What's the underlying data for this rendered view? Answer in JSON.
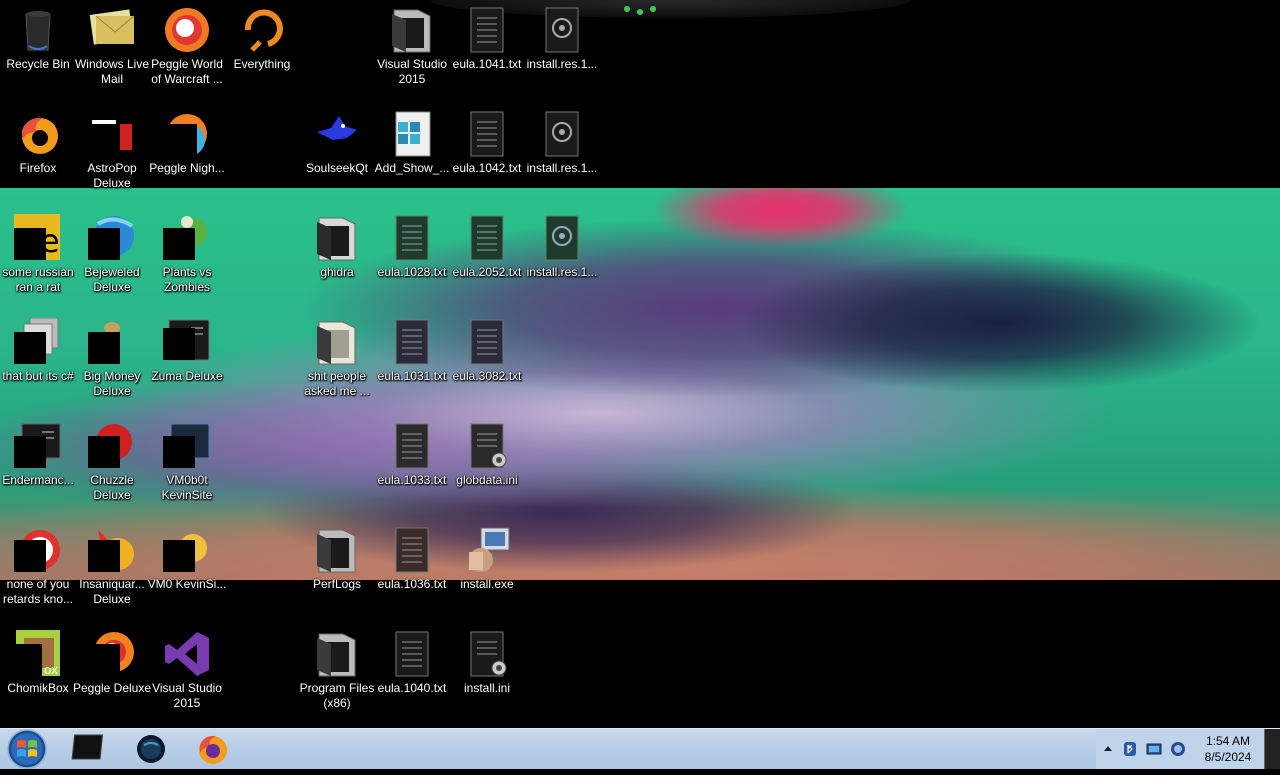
{
  "desktop": {
    "icons": [
      {
        "label": "Recycle Bin",
        "icon": "recycle-bin-icon"
      },
      {
        "label": "Windows Live Mail",
        "icon": "windows-live-mail-icon"
      },
      {
        "label": "Peggle World of Warcraft ...",
        "icon": "peggle-wow-icon"
      },
      {
        "label": "Everything",
        "icon": "everything-search-icon"
      },
      {
        "label": "Visual Studio 2015",
        "icon": "folder-icon"
      },
      {
        "label": "eula.1041.txt",
        "icon": "text-file-icon"
      },
      {
        "label": "install.res.1...",
        "icon": "resource-file-icon"
      },
      {
        "label": "Firefox",
        "icon": "firefox-icon"
      },
      {
        "label": "AstroPop Deluxe",
        "icon": "astropop-icon"
      },
      {
        "label": "Peggle Nigh...",
        "icon": "peggle-nights-icon"
      },
      {
        "label": "SoulseekQt",
        "icon": "soulseek-bird-icon"
      },
      {
        "label": "Add_Show_...",
        "icon": "registry-file-icon"
      },
      {
        "label": "eula.1042.txt",
        "icon": "text-file-icon"
      },
      {
        "label": "install.res.1...",
        "icon": "resource-file-icon"
      },
      {
        "label": "some russian ran a rat",
        "icon": "shortcut-icon"
      },
      {
        "label": "Bejeweled Deluxe",
        "icon": "bejeweled-icon"
      },
      {
        "label": "Plants vs Zombies",
        "icon": "plants-vs-zombies-icon"
      },
      {
        "label": "ghidra",
        "icon": "folder-icon"
      },
      {
        "label": "eula.1028.txt",
        "icon": "text-file-icon"
      },
      {
        "label": "eula.2052.txt",
        "icon": "text-file-icon"
      },
      {
        "label": "install.res.1...",
        "icon": "resource-file-icon"
      },
      {
        "label": "that but its c#",
        "icon": "files-icon"
      },
      {
        "label": "Big Money Deluxe",
        "icon": "big-money-icon"
      },
      {
        "label": "Zuma Deluxe",
        "icon": "zuma-icon"
      },
      {
        "label": "shit people asked me ...",
        "icon": "folder-icon"
      },
      {
        "label": "eula.1031.txt",
        "icon": "text-file-icon"
      },
      {
        "label": "eula.3082.txt",
        "icon": "text-file-icon"
      },
      {
        "label": "Endermanc...",
        "icon": "shortcut-icon"
      },
      {
        "label": "Chuzzle Deluxe",
        "icon": "chuzzle-icon"
      },
      {
        "label": "VM0b0t KevinSite",
        "icon": "shortcut-icon"
      },
      {
        "label": "eula.1033.txt",
        "icon": "text-file-icon"
      },
      {
        "label": "globdata.ini",
        "icon": "settings-file-icon"
      },
      {
        "label": "none of you retards kno...",
        "icon": "shortcut-icon"
      },
      {
        "label": "Insaniquar... Deluxe",
        "icon": "insaniquarium-icon"
      },
      {
        "label": "VM0 KevinSi...",
        "icon": "shortcut-icon"
      },
      {
        "label": "PerfLogs",
        "icon": "folder-icon"
      },
      {
        "label": "eula.1036.txt",
        "icon": "text-file-icon"
      },
      {
        "label": "install.exe",
        "icon": "installer-icon"
      },
      {
        "label": "ChomikBox",
        "icon": "chomikbox-icon"
      },
      {
        "label": "Peggle Deluxe",
        "icon": "peggle-icon"
      },
      {
        "label": "Visual Studio 2015",
        "icon": "visual-studio-icon"
      },
      {
        "label": "Program Files (x86)",
        "icon": "folder-icon"
      },
      {
        "label": "eula.1040.txt",
        "icon": "text-file-icon"
      },
      {
        "label": "install.ini",
        "icon": "settings-file-icon"
      }
    ]
  },
  "taskbar": {
    "start": {
      "icon": "windows-start-orb-icon"
    },
    "pinned": [
      {
        "icon": "terminal-icon"
      },
      {
        "icon": "globe-app-icon"
      },
      {
        "icon": "firefox-icon"
      }
    ],
    "tray": {
      "icons": [
        "show-hidden-icons-arrow-icon",
        "bluetooth-icon",
        "network-icon",
        "volume-icon"
      ],
      "time": "1:54 AM",
      "date": "8/5/2024"
    }
  },
  "colors": {
    "taskbar": "#b6cde6",
    "wallpaper_green": "#29c08a",
    "wallpaper_pink": "#e8306a",
    "wallpaper_purple": "#5a3a7a"
  }
}
